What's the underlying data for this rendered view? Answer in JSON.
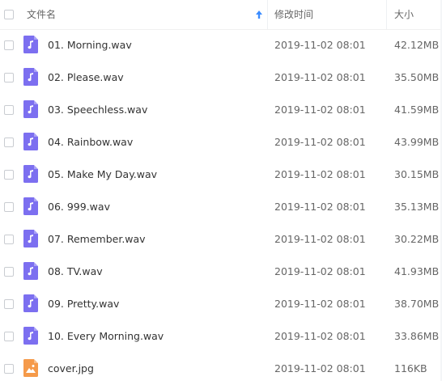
{
  "header": {
    "name_label": "文件名",
    "modified_label": "修改时间",
    "size_label": "大小",
    "sort_direction": "ascending"
  },
  "colors": {
    "audio_icon": "#7c6ff0",
    "image_icon": "#f59a4a",
    "sort_arrow": "#3b8cff"
  },
  "files": [
    {
      "name": "01. Morning.wav",
      "modified": "2019-11-02 08:01",
      "size": "42.12MB",
      "icon": "audio-file-icon"
    },
    {
      "name": "02. Please.wav",
      "modified": "2019-11-02 08:01",
      "size": "35.50MB",
      "icon": "audio-file-icon"
    },
    {
      "name": "03. Speechless.wav",
      "modified": "2019-11-02 08:01",
      "size": "41.59MB",
      "icon": "audio-file-icon"
    },
    {
      "name": "04. Rainbow.wav",
      "modified": "2019-11-02 08:01",
      "size": "43.99MB",
      "icon": "audio-file-icon"
    },
    {
      "name": "05. Make My Day.wav",
      "modified": "2019-11-02 08:01",
      "size": "30.15MB",
      "icon": "audio-file-icon"
    },
    {
      "name": "06. 999.wav",
      "modified": "2019-11-02 08:01",
      "size": "35.13MB",
      "icon": "audio-file-icon"
    },
    {
      "name": "07. Remember.wav",
      "modified": "2019-11-02 08:01",
      "size": "30.22MB",
      "icon": "audio-file-icon"
    },
    {
      "name": "08. TV.wav",
      "modified": "2019-11-02 08:01",
      "size": "41.93MB",
      "icon": "audio-file-icon"
    },
    {
      "name": "09. Pretty.wav",
      "modified": "2019-11-02 08:01",
      "size": "38.70MB",
      "icon": "audio-file-icon"
    },
    {
      "name": "10. Every Morning.wav",
      "modified": "2019-11-02 08:01",
      "size": "33.86MB",
      "icon": "audio-file-icon"
    },
    {
      "name": "cover.jpg",
      "modified": "2019-11-02 08:01",
      "size": "116KB",
      "icon": "image-file-icon"
    }
  ]
}
